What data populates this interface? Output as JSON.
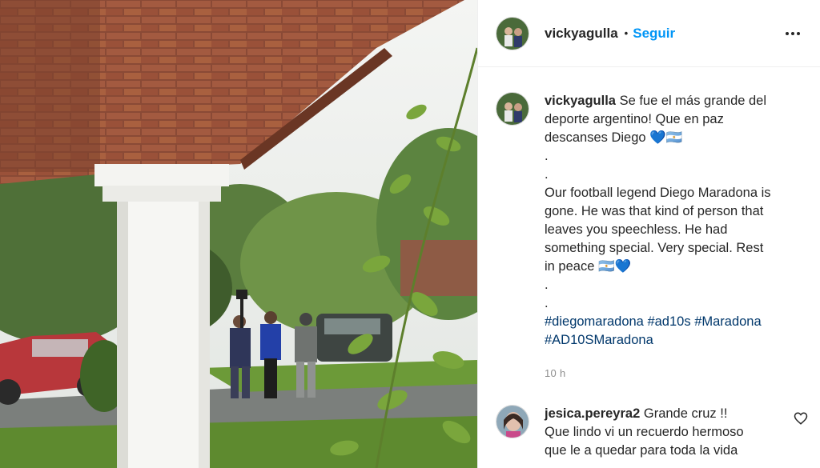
{
  "post": {
    "username": "vickyagulla",
    "follow_label": "Seguir",
    "dot": "•",
    "caption_lines": [
      "Se fue el más grande del",
      "deporte argentino! Que en paz",
      "descanses Diego 💙🇦🇷",
      ".",
      ".",
      "Our football legend Diego Maradona is",
      "gone. He was that kind of person that",
      "leaves you speechless. He had",
      "something special. Very special. Rest",
      "in peace 🇦🇷💙",
      ".",
      "."
    ],
    "hashtags_line1": [
      "#diegomaradona",
      "#ad10s",
      "#Maradona"
    ],
    "hashtags_line2": [
      "#AD10SMaradona"
    ],
    "time_ago": "10 h"
  },
  "comment": {
    "username": "jesica.pereyra2",
    "text_line1": "Grande cruz !!",
    "text_line2": "Que lindo vi un recuerdo hermoso",
    "text_line3": "que le a quedar para toda la vida"
  },
  "icons": {
    "more": "more-options-icon",
    "like": "heart-icon"
  },
  "colors": {
    "link_blue": "#0095f6",
    "hashtag": "#00376b",
    "muted": "#8e8e8e"
  }
}
